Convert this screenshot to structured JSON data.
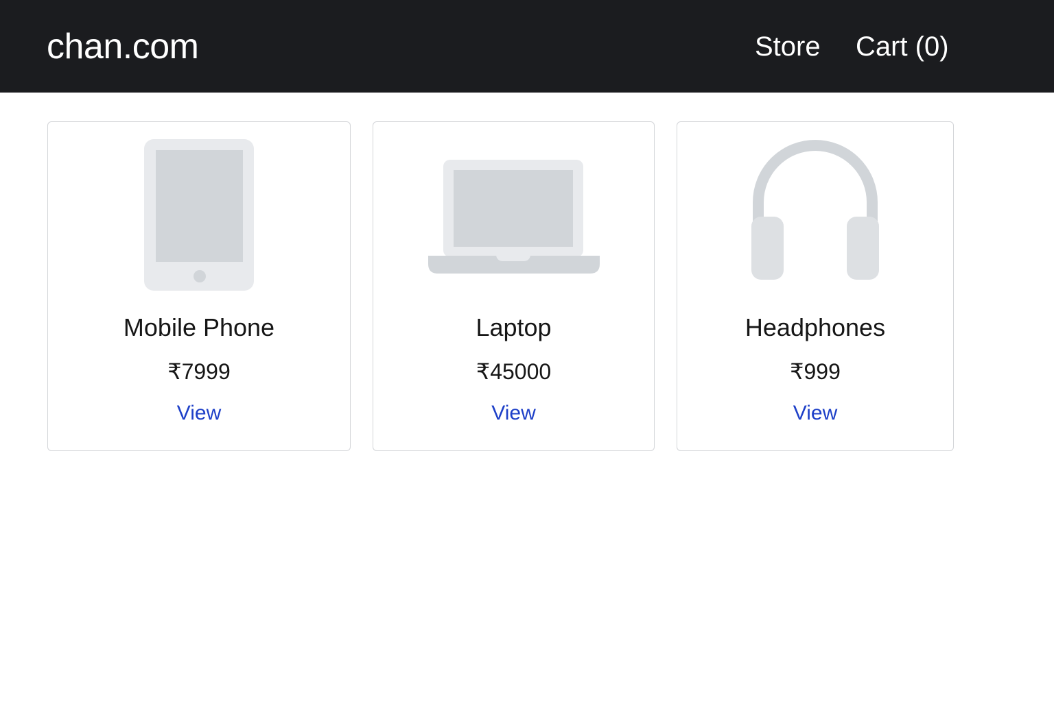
{
  "navbar": {
    "brand": "chan.com",
    "links": [
      {
        "label": "Store"
      },
      {
        "label": "Cart (0)"
      }
    ]
  },
  "products": [
    {
      "name": "Mobile Phone",
      "price": "₹7999",
      "link_label": "View",
      "icon": "tablet-phone-icon"
    },
    {
      "name": "Laptop",
      "price": "₹45000",
      "link_label": "View",
      "icon": "laptop-icon"
    },
    {
      "name": "Headphones",
      "price": "₹999",
      "link_label": "View",
      "icon": "headphones-icon"
    }
  ],
  "colors": {
    "navbar_bg": "#1b1c1f",
    "link": "#1e40c8",
    "placeholder_light": "#e8eaed",
    "placeholder_dark": "#d1d5d9",
    "card_border": "#d3d5d8"
  }
}
